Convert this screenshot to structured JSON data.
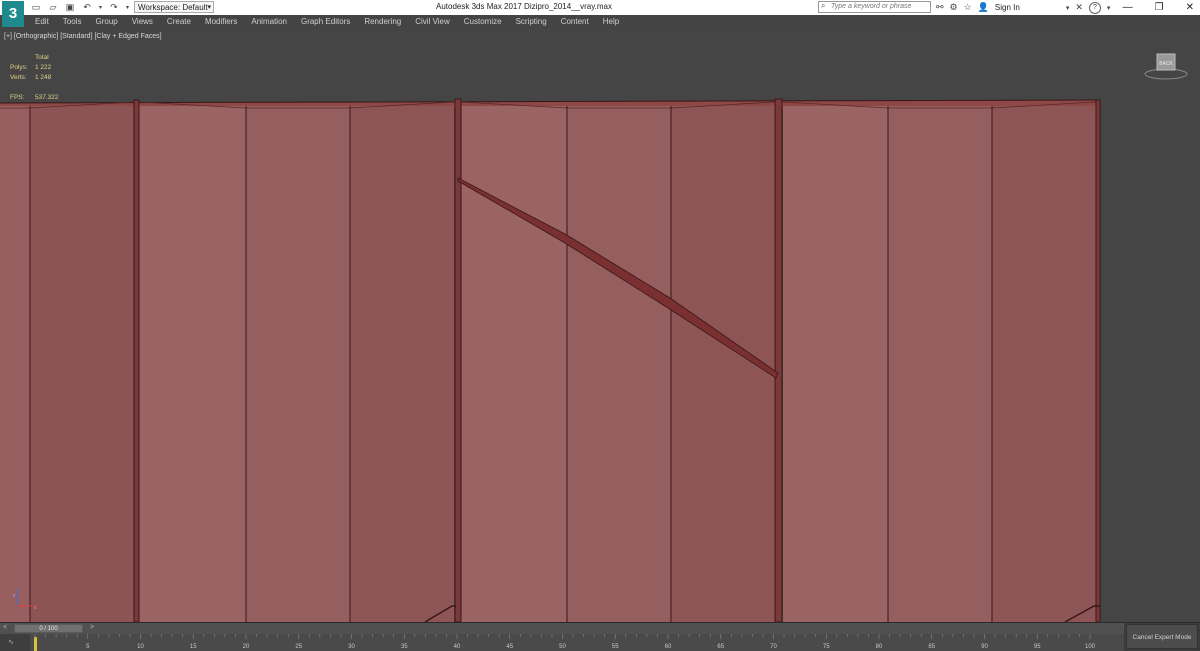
{
  "app": {
    "logo_text": "3",
    "title": "Autodesk 3ds Max 2017     Dizipro_2014__vray.max",
    "workspace": "Workspace: Default"
  },
  "quick_access_icons": [
    "new-file-icon",
    "open-folder-icon",
    "save-icon",
    "undo-icon",
    "redo-icon",
    "project-folder-icon"
  ],
  "search": {
    "placeholder": "Type a keyword or phrase"
  },
  "user": {
    "sign_in": "Sign In"
  },
  "menu": [
    "Edit",
    "Tools",
    "Group",
    "Views",
    "Create",
    "Modifiers",
    "Animation",
    "Graph Editors",
    "Rendering",
    "Civil View",
    "Customize",
    "Scripting",
    "Content",
    "Help"
  ],
  "viewport": {
    "label": "[+] [Orthographic] [Standard] [Clay + Edged Faces]",
    "stats": {
      "header": "Total",
      "polys_label": "Polys:",
      "polys": "1 222",
      "verts_label": "Verts:",
      "verts": "1 248",
      "fps_label": "FPS:",
      "fps": "537.322"
    },
    "viewcube_label": "BACK"
  },
  "timeline": {
    "frame_display": "0 / 100",
    "ticks": [
      "0",
      "5",
      "10",
      "15",
      "20",
      "25",
      "30",
      "35",
      "40",
      "45",
      "50",
      "55",
      "60",
      "65",
      "70",
      "75",
      "80",
      "85",
      "90",
      "95",
      "100"
    ],
    "cancel_expert": "Cancel Expert Mode"
  },
  "colors": {
    "viewport_bg": "#454545",
    "wall_face": "#975f60",
    "wall_edge": "#3a1616",
    "stats_text": "#e0d18a",
    "logo": "#1f8a8e"
  }
}
